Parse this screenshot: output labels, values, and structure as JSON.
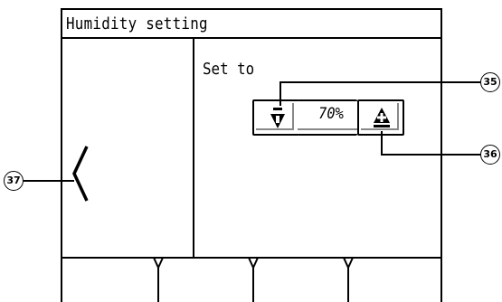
{
  "screen": {
    "title": "Humidity setting",
    "set_to_label": "Set to",
    "humidity_value": "70%"
  },
  "callouts": {
    "decrease": "35",
    "increase": "36",
    "back": "37"
  },
  "icons": {
    "decrease": "down-arrow-minus-icon",
    "increase": "up-arrow-plus-icon",
    "back": "chevron-left-icon"
  },
  "footer": {
    "buttons": [
      "",
      "",
      "",
      ""
    ]
  }
}
